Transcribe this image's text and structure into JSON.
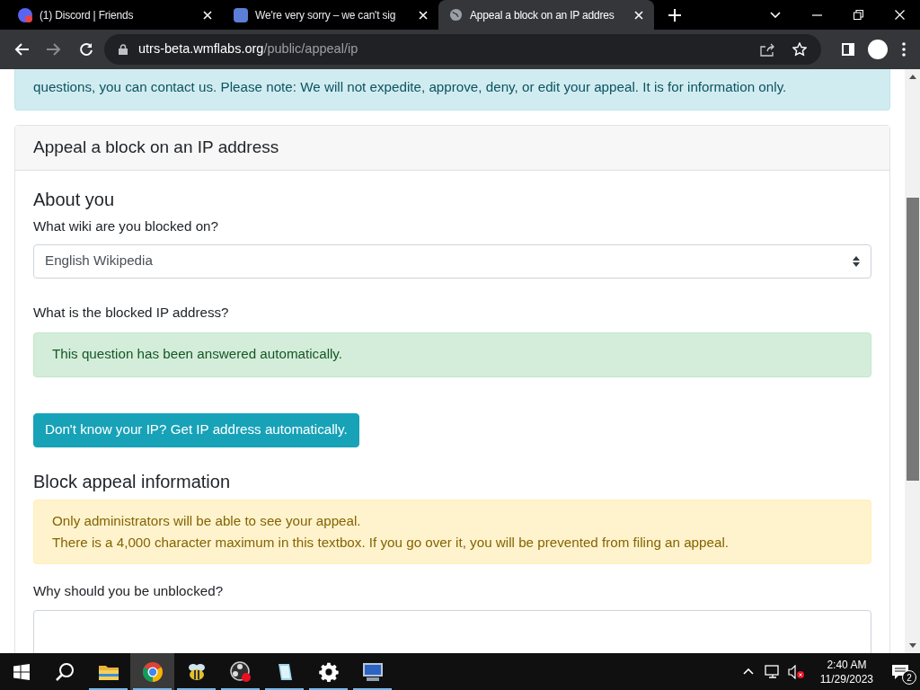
{
  "tabs": [
    {
      "title": "(1) Discord | Friends",
      "selected": false
    },
    {
      "title": "We're very sorry – we can't sig",
      "selected": false
    },
    {
      "title": "Appeal a block on an IP addres",
      "selected": true
    }
  ],
  "address_bar": {
    "host": "utrs-beta.wmflabs.org",
    "path": "/public/appeal/ip"
  },
  "info_notice": "questions, you can contact us. Please note: We will not expedite, approve, deny, or edit your appeal. It is for information only.",
  "card": {
    "title": "Appeal a block on an IP address",
    "about_heading": "About you",
    "wiki_label": "What wiki are you blocked on?",
    "wiki_value": "English Wikipedia",
    "ip_label": "What is the blocked IP address?",
    "ip_notice": "This question has been answered automatically.",
    "ip_button": "Don't know your IP? Get IP address automatically.",
    "appeal_heading": "Block appeal information",
    "appeal_notices": [
      "Only administrators will be able to see your appeal.",
      "There is a 4,000 character maximum in this textbox. If you go over it, you will be prevented from filing an appeal."
    ],
    "reason_label": "Why should you be unblocked?"
  },
  "taskbar": {
    "apps": [
      {
        "kind": "folder",
        "running": true,
        "selected": false
      },
      {
        "kind": "chrome",
        "running": true,
        "selected": true
      },
      {
        "kind": "bee",
        "running": true,
        "selected": false
      },
      {
        "kind": "recorder",
        "running": true,
        "selected": false
      },
      {
        "kind": "notepad",
        "running": true,
        "selected": false
      },
      {
        "kind": "gear",
        "running": true,
        "selected": false
      },
      {
        "kind": "computer",
        "running": true,
        "selected": false
      }
    ],
    "time": "2:40 AM",
    "date": "11/29/2023",
    "notifications": "2"
  }
}
